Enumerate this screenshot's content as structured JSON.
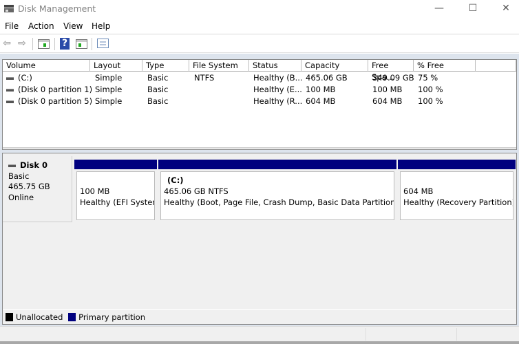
{
  "window": {
    "title": "Disk Management",
    "minimize": "—",
    "maximize": "☐",
    "close": "✕"
  },
  "menu": [
    "File",
    "Action",
    "View",
    "Help"
  ],
  "toolbar": {
    "back": "⇦",
    "forward": "⇨",
    "help": "?"
  },
  "volumes": {
    "columns": [
      "Volume",
      "Layout",
      "Type",
      "File System",
      "Status",
      "Capacity",
      "Free Spa...",
      "% Free"
    ],
    "rows": [
      [
        "(C:)",
        "Simple",
        "Basic",
        "NTFS",
        "Healthy (B...",
        "465.06 GB",
        "349.09 GB",
        "75 %"
      ],
      [
        "(Disk 0 partition 1)",
        "Simple",
        "Basic",
        "",
        "Healthy (E...",
        "100 MB",
        "100 MB",
        "100 %"
      ],
      [
        "(Disk 0 partition 5)",
        "Simple",
        "Basic",
        "",
        "Healthy (R...",
        "604 MB",
        "604 MB",
        "100 %"
      ]
    ]
  },
  "disk": {
    "name": "Disk 0",
    "type": "Basic",
    "size": "465.75 GB",
    "state": "Online",
    "partitions": [
      {
        "label": "",
        "size": "100 MB",
        "status": "Healthy (EFI System"
      },
      {
        "label": "(C:)",
        "size": "465.06 GB NTFS",
        "status": "Healthy (Boot, Page File, Crash Dump, Basic Data Partition)"
      },
      {
        "label": "",
        "size": "604 MB",
        "status": "Healthy (Recovery Partition)"
      }
    ]
  },
  "legend": [
    {
      "label": "Unallocated",
      "color": "#000000"
    },
    {
      "label": "Primary partition",
      "color": "#00007f"
    }
  ]
}
